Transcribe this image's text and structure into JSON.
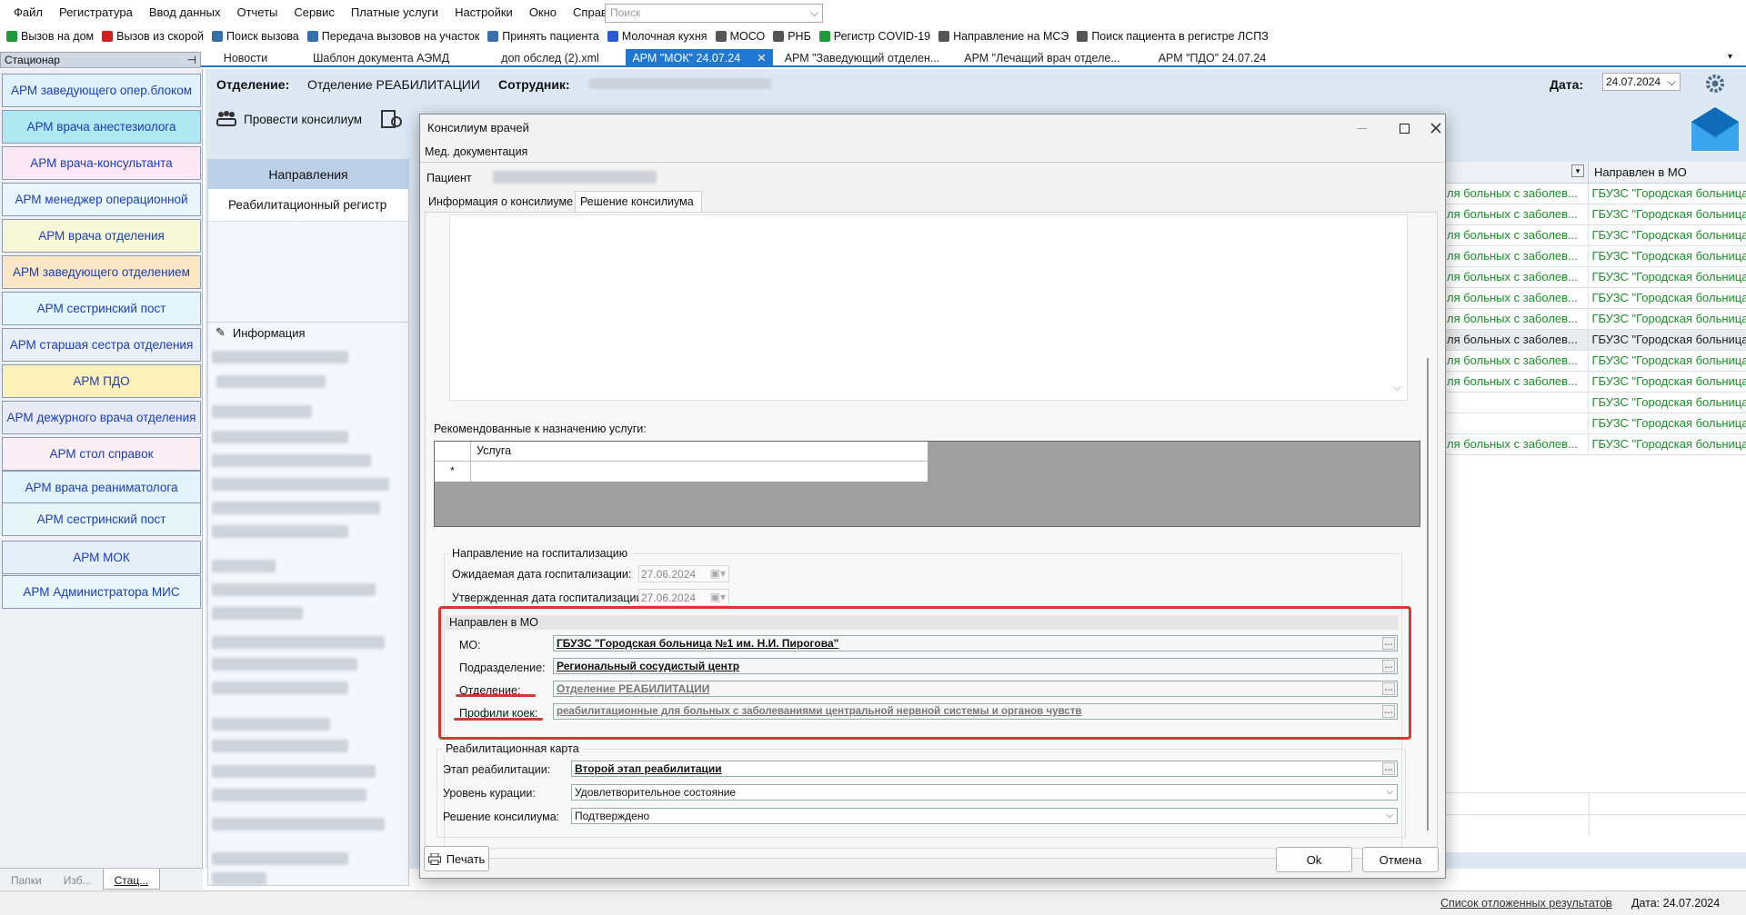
{
  "menu": [
    "Файл",
    "Регистратура",
    "Ввод данных",
    "Отчеты",
    "Сервис",
    "Платные услуги",
    "Настройки",
    "Окно",
    "Справка"
  ],
  "search": {
    "placeholder": "Поиск"
  },
  "toolbar": [
    "Вызов на дом",
    "Вызов из скорой",
    "Поиск вызова",
    "Передача вызовов на участок",
    "Принять пациента",
    "Молочная кухня",
    "МОСО",
    "РНБ",
    "Регистр COVID-19",
    "Направление на МСЭ",
    "Поиск пациента в регистре ЛСПЗ"
  ],
  "left_panel_title": "Стационар",
  "doc_tabs": [
    "Новости",
    "Шаблон документа АЭМД",
    "доп обслед (2).xml",
    "АРМ \"МОК\" 24.07.24",
    "АРМ \"Заведующий отделен...",
    "АРМ \"Лечащий врач отделе...",
    "АРМ \"ПДО\" 24.07.24"
  ],
  "sidebar": [
    {
      "label": "АРМ заведующего опер.блоком",
      "color": "#dff2fb"
    },
    {
      "label": "АРМ врача анестезиолога",
      "color": "#aee8f0"
    },
    {
      "label": "АРМ врача-консультанта",
      "color": "#fbe8f4"
    },
    {
      "label": "АРМ менеджер  операционной",
      "color": "#e8f6fb"
    },
    {
      "label": "АРМ врача отделения",
      "color": "#f6f8d8"
    },
    {
      "label": "АРМ заведующего отделением",
      "color": "#fbe7c6"
    },
    {
      "label": "АРМ сестринский пост",
      "color": "#e2f6fb"
    },
    {
      "label": "АРМ старшая сестра отделения",
      "color": "#eaeef5"
    },
    {
      "label": "АРМ ПДО",
      "color": "#fdf0b8"
    },
    {
      "label": "АРМ дежурного врача отделения",
      "color": "#e8ebf3"
    },
    {
      "label": "АРМ стол справок",
      "color": "#fbeef4"
    },
    {
      "label": "АРМ врача реаниматолога",
      "color": "#e2f3fb"
    },
    {
      "label": "АРМ сестринский пост",
      "color": "#e6f6f8"
    },
    {
      "label": "АРМ МОК",
      "color": "#e6eef8"
    },
    {
      "label": "АРМ Администратора МИС",
      "color": "#e8f5fb"
    }
  ],
  "side_tabs": [
    "Папки",
    "Изб...",
    "Стац..."
  ],
  "header": {
    "department_label": "Отделение:",
    "department_value": "Отделение РЕАБИЛИТАЦИИ",
    "employee_label": "Сотрудник:",
    "date_label": "Дата:",
    "date_value": "24.07.2024",
    "hold_consilium": "Провести консилиум"
  },
  "nav": {
    "head": "Направления",
    "item": "Реабилитационный регистр",
    "info": "Информация"
  },
  "grid": {
    "header_col2": "Направлен в МО",
    "rows": [
      {
        "c1": "ля больных с заболев...",
        "c2": "ГБУЗС \"Городская больница"
      },
      {
        "c1": "ля больных с заболев...",
        "c2": "ГБУЗС \"Городская больница"
      },
      {
        "c1": "ля больных с заболев...",
        "c2": "ГБУЗС \"Городская больница"
      },
      {
        "c1": "ля больных с заболев...",
        "c2": "ГБУЗС \"Городская больница"
      },
      {
        "c1": "ля больных с заболев...",
        "c2": "ГБУЗС \"Городская больница"
      },
      {
        "c1": "ля больных с заболев...",
        "c2": "ГБУЗС \"Городская больница"
      },
      {
        "c1": "ля больных с заболев...",
        "c2": "ГБУЗС \"Городская больница"
      },
      {
        "c1": "ля больных с заболев...",
        "c2": "ГБУЗС \"Городская больница"
      },
      {
        "c1": "ля больных с заболев...",
        "c2": "ГБУЗС \"Городская больница"
      },
      {
        "c1": "ля больных с заболев...",
        "c2": "ГБУЗС \"Городская больница"
      },
      {
        "c1": "",
        "c2": "ГБУЗС \"Городская больница"
      },
      {
        "c1": "",
        "c2": "ГБУЗС \"Городская больница"
      },
      {
        "c1": "ля больных с заболев...",
        "c2": "ГБУЗС \"Городская больница"
      }
    ]
  },
  "status": {
    "deferred": "Список отложенных результатов",
    "date": "Дата: 24.07.2024"
  },
  "dialog": {
    "title": "Консилиум врачей",
    "menu": "Мед. документация",
    "patient_label": "Пациент",
    "tabs": [
      "Информация о консилиуме",
      "Решение консилиума"
    ],
    "recommended_label": "Рекомендованные к назначению услуги:",
    "services_col": "Услуга",
    "services_marker": "*",
    "hosp_group": "Направление на госпитализацию",
    "expected_label": "Ожидаемая дата госпитализации:",
    "expected_value": "27.06.2024",
    "approved_label": "Утвержденная дата госпитализации:",
    "approved_value": "27.06.2024",
    "mo_group": "Направлен в МО",
    "mo_label": "МО:",
    "mo_value": "ГБУЗС \"Городская больница №1 им. Н.И. Пирогова\"",
    "sub_label": "Подразделение:",
    "sub_value": "Региональный сосудистый центр",
    "dept_label": "Отделение:",
    "dept_value": "Отделение РЕАБИЛИТАЦИИ",
    "beds_label": "Профили коек:",
    "beds_value": "реабилитационные для больных с заболеваниями центральной нервной системы и органов чувств",
    "rehab_group": "Реабилитационная карта",
    "stage_label": "Этап реабилитации:",
    "stage_value": "Второй этап реабилитации",
    "level_label": "Уровень курации:",
    "level_value": "Удовлетворительное состояние",
    "decision_label": "Решение консилиума:",
    "decision_value": "Подтверждено",
    "print": "Печать",
    "ok": "Ok",
    "cancel": "Отмена"
  }
}
